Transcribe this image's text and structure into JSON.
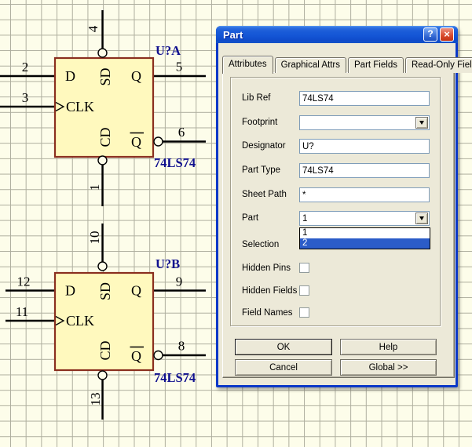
{
  "schematic": {
    "colors": {
      "background": "#fdfdea",
      "grid": "#aeae9e",
      "part_fill": "#fff9be",
      "part_border": "#8a2f1f",
      "wire": "#000000",
      "designator_text": "#10108e"
    },
    "flipflops": [
      {
        "designator": "U?A",
        "part_type": "74LS74",
        "pins": {
          "d": "2",
          "clk": "3",
          "sd": "4",
          "q": "5",
          "qbar": "6",
          "cd": "1"
        },
        "labels": {
          "d": "D",
          "clk": "CLK",
          "sd": "SD",
          "cd": "CD",
          "q": "Q",
          "qbar": "Q"
        }
      },
      {
        "designator": "U?B",
        "part_type": "74LS74",
        "pins": {
          "d": "12",
          "clk": "11",
          "sd": "10",
          "q": "9",
          "qbar": "8",
          "cd": "13"
        },
        "labels": {
          "d": "D",
          "clk": "CLK",
          "sd": "SD",
          "cd": "CD",
          "q": "Q",
          "qbar": "Q"
        }
      }
    ]
  },
  "dialog": {
    "title": "Part",
    "titlebar_buttons": {
      "help": "?",
      "close": "×"
    },
    "tabs": [
      {
        "label": "Attributes",
        "active": true
      },
      {
        "label": "Graphical Attrs",
        "active": false
      },
      {
        "label": "Part Fields",
        "active": false
      },
      {
        "label": "Read-Only Fields",
        "active": false
      }
    ],
    "fields": [
      {
        "label": "Lib Ref",
        "value": "74LS74",
        "type": "text"
      },
      {
        "label": "Footprint",
        "value": "",
        "type": "combo"
      },
      {
        "label": "Designator",
        "value": "U?",
        "type": "text"
      },
      {
        "label": "Part Type",
        "value": "74LS74",
        "type": "text"
      },
      {
        "label": "Sheet Path",
        "value": "*",
        "type": "text"
      },
      {
        "label": "Part",
        "value": "1",
        "type": "combo",
        "dropdown_open": true,
        "options": [
          "1",
          "2"
        ],
        "highlighted_option": "2"
      }
    ],
    "selection": {
      "label": "Selection",
      "checked": false
    },
    "checkboxes": [
      {
        "label": "Hidden Pins",
        "checked": false
      },
      {
        "label": "Hidden Fields",
        "checked": false
      },
      {
        "label": "Field Names",
        "checked": false
      }
    ],
    "buttons": [
      {
        "label": "OK",
        "default": true
      },
      {
        "label": "Cancel",
        "default": false
      },
      {
        "label": "Help",
        "default": false
      },
      {
        "label": "Global >>",
        "default": false
      }
    ],
    "colors": {
      "list_highlight": "#2b5cc8",
      "client": "#ece9d8",
      "border": "#0b38c8"
    }
  }
}
